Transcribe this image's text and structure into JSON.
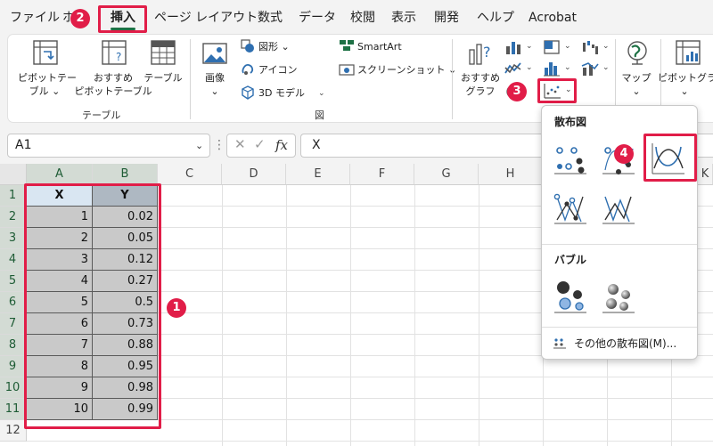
{
  "ribbon_tabs": [
    "ファイル",
    "ホ",
    "挿入",
    "ページ レイアウト",
    "数式",
    "データ",
    "校閲",
    "表示",
    "開発",
    "ヘルプ",
    "Acrobat"
  ],
  "active_tab": "挿入",
  "ribbon": {
    "pivot_table": [
      "ピボットテー",
      "ブル ⌄"
    ],
    "recommended_pivot": [
      "おすすめ",
      "ピボットテーブル"
    ],
    "table": "テーブル",
    "group_table": "テーブル",
    "image": [
      "画像",
      "⌄"
    ],
    "shapes": "図形 ⌄",
    "icons": "アイコン",
    "models_3d": "3D モデル",
    "smartart": "SmartArt",
    "screenshot": "スクリーンショット ⌄",
    "group_figure": "図",
    "recommended_charts": [
      "おすすめ",
      "グラフ"
    ],
    "maps": [
      "マップ",
      "⌄"
    ],
    "pivot_chart": [
      "ピボットグラフ",
      "⌄"
    ]
  },
  "formula_bar": {
    "name_box": "A1",
    "fx": "fx",
    "content": "X"
  },
  "columns": [
    "A",
    "B",
    "C",
    "D",
    "E",
    "F",
    "G",
    "H",
    "K"
  ],
  "rows": [
    "1",
    "2",
    "3",
    "4",
    "5",
    "6",
    "7",
    "8",
    "9",
    "10",
    "11",
    "12"
  ],
  "table": {
    "headers": [
      "X",
      "Y"
    ],
    "rows": [
      [
        "1",
        "0.02"
      ],
      [
        "2",
        "0.05"
      ],
      [
        "3",
        "0.12"
      ],
      [
        "4",
        "0.27"
      ],
      [
        "5",
        "0.5"
      ],
      [
        "6",
        "0.73"
      ],
      [
        "7",
        "0.88"
      ],
      [
        "8",
        "0.95"
      ],
      [
        "9",
        "0.98"
      ],
      [
        "10",
        "0.99"
      ]
    ]
  },
  "scatter_menu": {
    "scatter_heading": "散布図",
    "bubble_heading": "バブル",
    "more_label": "その他の散布図(M)..."
  },
  "steps": [
    "1",
    "2",
    "3",
    "4"
  ],
  "colors": {
    "highlight": "#e11d48",
    "excel_green": "#1e7145",
    "icon_blue": "#2f6fb0"
  }
}
